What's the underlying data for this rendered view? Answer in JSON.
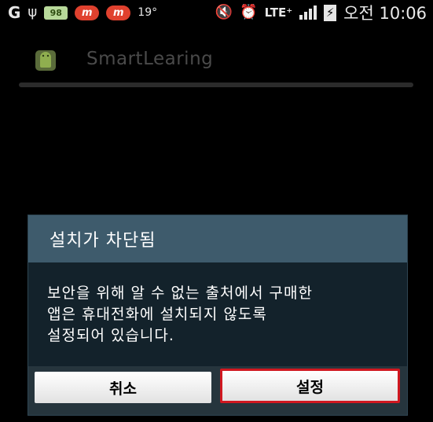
{
  "status_bar": {
    "battery_chip": "98",
    "app_chip": "m",
    "temperature": "19°",
    "network": "LTE⁺",
    "clock": "오전 10:06"
  },
  "app": {
    "title": "SmartLearing"
  },
  "dialog": {
    "title": "설치가 차단됨",
    "message_lines": [
      "보안을 위해 알 수 없는 출처에서 구매한",
      "앱은 휴대전화에 설치되지 않도록",
      "설정되어 있습니다."
    ],
    "cancel_label": "취소",
    "settings_label": "설정"
  },
  "colors": {
    "dialog_header": "#3e5b6c",
    "dialog_body": "#13222b",
    "highlight_border": "#d01820"
  }
}
